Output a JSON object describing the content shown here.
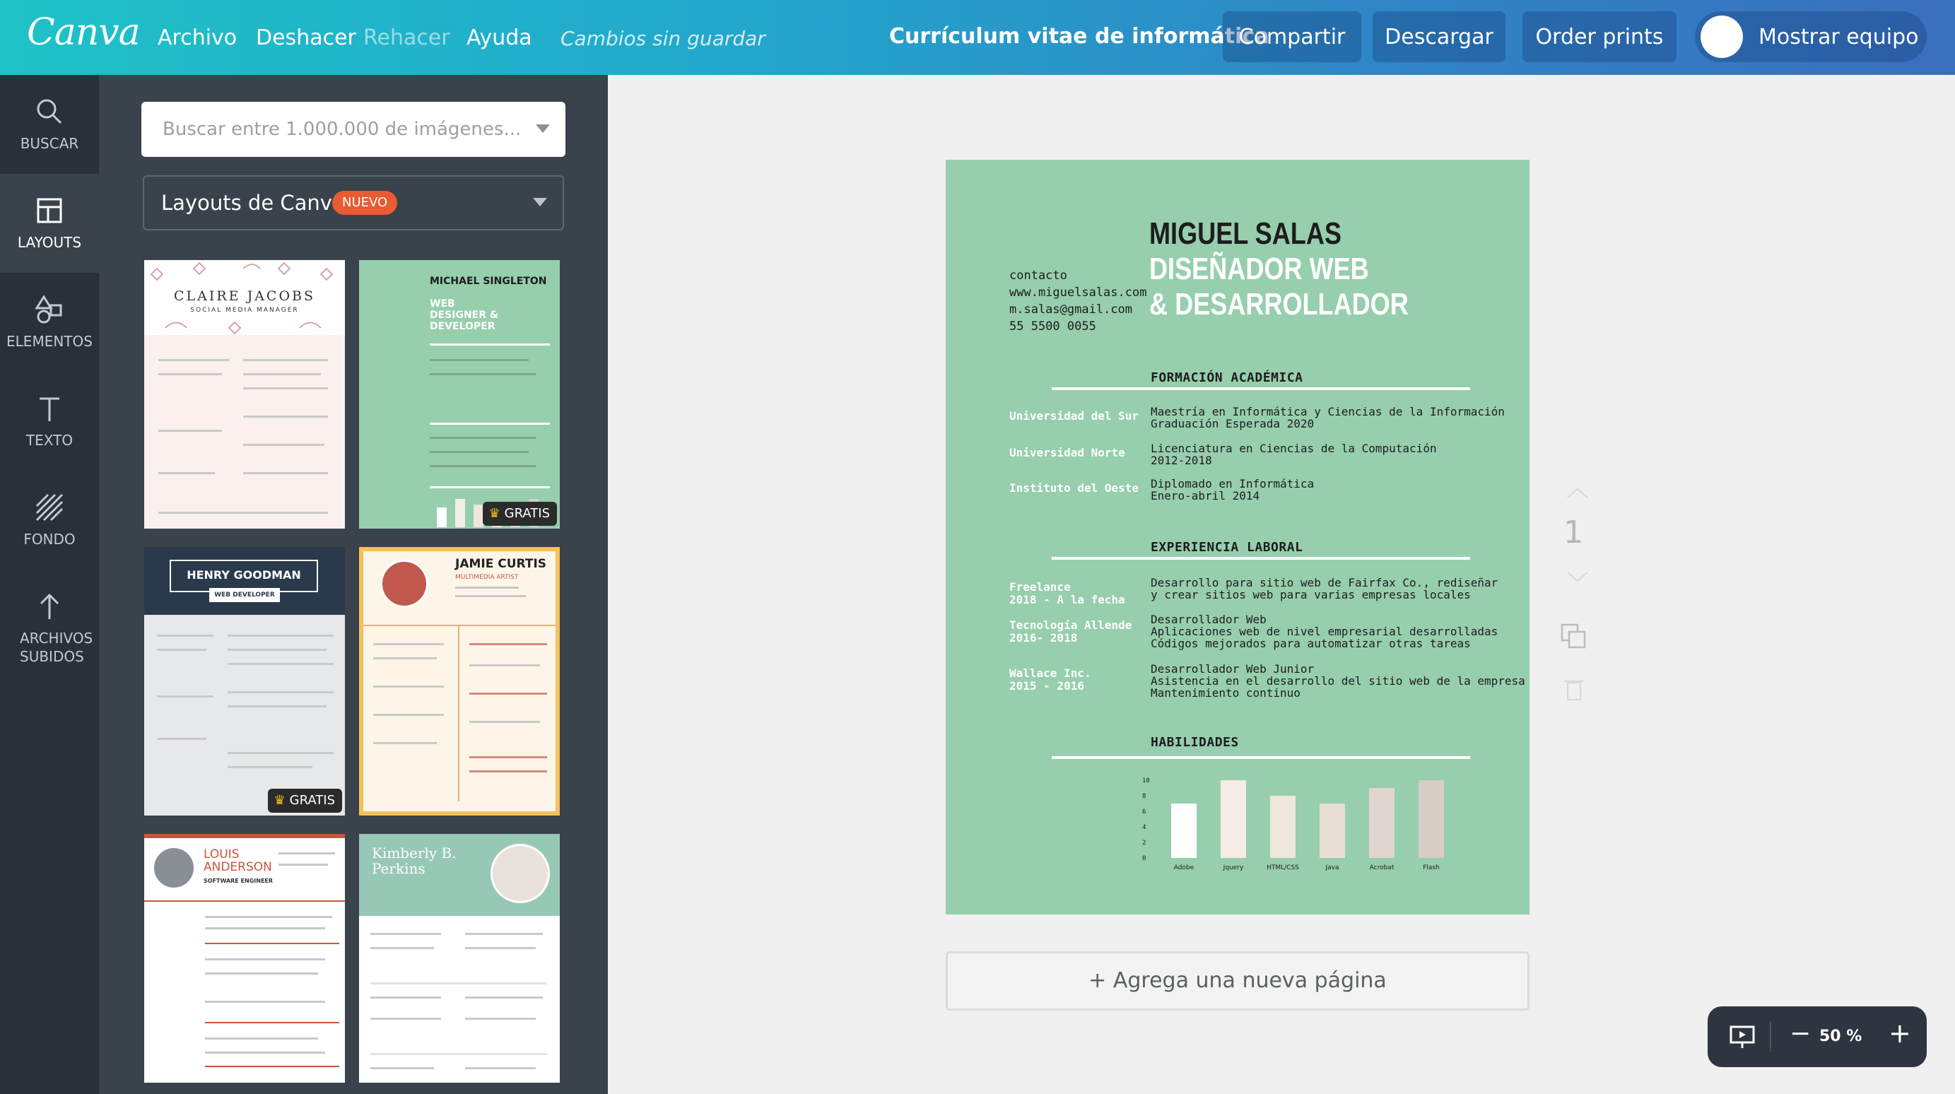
{
  "topbar": {
    "logo": "Canva",
    "menu": [
      "Archivo",
      "Deshacer",
      "Rehacer",
      "Ayuda"
    ],
    "status": "Cambios sin guardar",
    "doc_title": "Currículum vitae de informática",
    "share": "Compartir",
    "download": "Descargar",
    "order": "Order prints",
    "team": "Mostrar equipo"
  },
  "rail": [
    {
      "label": "BUSCAR",
      "icon": "search-icon"
    },
    {
      "label": "LAYOUTS",
      "icon": "layouts-icon"
    },
    {
      "label": "ELEMENTOS",
      "icon": "shapes-icon"
    },
    {
      "label": "TEXTO",
      "icon": "text-icon"
    },
    {
      "label": "FONDO",
      "icon": "background-icon"
    },
    {
      "label": "ARCHIVOS SUBIDOS",
      "icon": "upload-icon"
    }
  ],
  "panel": {
    "search_placeholder": "Buscar entre 1.000.000 de imágenes...",
    "layout_select": "Layouts de Canva",
    "new_badge": "NUEVO",
    "free_badge": "GRATIS",
    "templates": [
      {
        "name": "CLAIRE JACOBS",
        "subtitle": "SOCIAL MEDIA MANAGER"
      },
      {
        "name": "MICHAEL SINGLETON",
        "subtitle": "WEB DESIGNER & DEVELOPER",
        "free": true
      },
      {
        "name": "HENRY GOODMAN",
        "subtitle": "WEB DEVELOPER",
        "free": true
      },
      {
        "name": "JAMIE CURTIS",
        "subtitle": "MULTIMEDIA ARTIST"
      },
      {
        "name": "LOUIS ANDERSON",
        "subtitle": "SOFTWARE ENGINEER"
      },
      {
        "name": "Kimberly B. Perkins",
        "subtitle": ""
      }
    ]
  },
  "resume": {
    "name": "MIGUEL SALAS",
    "role_line1": "DISEÑADOR WEB",
    "role_line2": "& DESARROLLADOR",
    "contact_label": "contacto",
    "website": "www.miguelsalas.com",
    "email": "m.salas@gmail.com",
    "phone": "55 5500 0055",
    "education_title": "FORMACIÓN ACADÉMICA",
    "education": [
      {
        "school": "Universidad del Sur",
        "line1": "Maestría en Informática y Ciencias de la Información",
        "line2": "Graduación Esperada 2020"
      },
      {
        "school": "Universidad Norte",
        "line1": "Licenciatura en Ciencias de la Computación",
        "line2": "2012-2018"
      },
      {
        "school": "Instituto del Oeste",
        "line1": "Diplomado en Informática",
        "line2": "Enero-abril 2014"
      }
    ],
    "experience_title": "EXPERIENCIA LABORAL",
    "experience": [
      {
        "company": "Freelance",
        "dates": "2018 - A la fecha",
        "line1": "Desarrollo para sitio web de Fairfax Co., rediseñar",
        "line2": "y crear sitios web para varias empresas locales",
        "line3": ""
      },
      {
        "company": "Tecnología Allende",
        "dates": "2016- 2018",
        "line1": "Desarrollador Web",
        "line2": "Aplicaciones web de nivel empresarial desarrolladas",
        "line3": "Códigos mejorados para automatizar otras tareas"
      },
      {
        "company": "Wallace Inc.",
        "dates": "2015 - 2016",
        "line1": "Desarrollador Web Junior",
        "line2": "Asistencia en el desarrollo del sitio web de la empresa",
        "line3": "Mantenimiento continuo"
      }
    ],
    "skills_title": "HABILIDADES"
  },
  "chart_data": {
    "type": "bar",
    "categories": [
      "Adobe",
      "Jquery",
      "HTML/CSS",
      "Java",
      "Acrobat",
      "Flash"
    ],
    "values": [
      7,
      10,
      8,
      7,
      9,
      10
    ],
    "ylim": [
      0,
      10
    ],
    "yticks": [
      "10",
      "8",
      "6",
      "4",
      "2",
      "0"
    ],
    "colors": [
      "#ffffff",
      "#f5ece6",
      "#efe6de",
      "#e8ddd5",
      "#e0d6cf",
      "#d7ccc6"
    ]
  },
  "canvas": {
    "add_page": "+ Agrega una nueva página",
    "page_number": "1",
    "zoom": "50 %"
  }
}
